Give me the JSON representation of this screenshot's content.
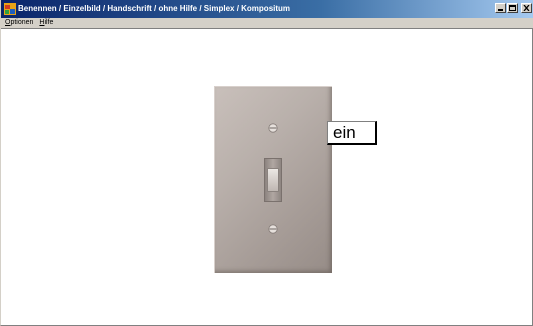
{
  "window": {
    "title": "Benennen / Einzelbild / Handschrift / ohne Hilfe / Simplex / Kompositum"
  },
  "menu": {
    "items": [
      {
        "accel": "O",
        "rest": "ptionen"
      },
      {
        "accel": "H",
        "rest": "ilfe"
      }
    ]
  },
  "main": {
    "image": "light-switch",
    "answer_label": "ein"
  }
}
